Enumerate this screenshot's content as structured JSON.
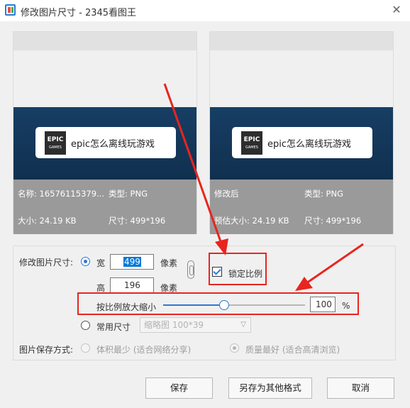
{
  "window": {
    "title": "修改图片尺寸 - 2345看图王",
    "close_glyph": "✕"
  },
  "preview_left": {
    "banner_logo_top": "EPIC",
    "banner_logo_bottom": "GAMES",
    "banner_text": "epic怎么离线玩游戏",
    "name_label": "名称: 16576115379...",
    "type_label": "类型: PNG",
    "size_label": "大小: 24.19 KB",
    "dims_label": "尺寸: 499*196"
  },
  "preview_right": {
    "banner_logo_top": "EPIC",
    "banner_logo_bottom": "GAMES",
    "banner_text": "epic怎么离线玩游戏",
    "name_label": "修改后",
    "type_label": "类型: PNG",
    "size_label": "预估大小: 24.19 KB",
    "dims_label": "尺寸: 499*196"
  },
  "resize": {
    "section_label": "修改图片尺寸:",
    "width_label": "宽",
    "width_value": "499",
    "width_unit": "像素",
    "height_label": "高",
    "height_value": "196",
    "height_unit": "像素",
    "lock_ratio_label": "锁定比例",
    "lock_ratio_checked": true,
    "scale_label": "按比例放大缩小",
    "scale_value": "100",
    "scale_fraction": 0.43,
    "scale_unit": "%",
    "common_size_label": "常用尺寸",
    "common_size_value": "缩略图 100*39",
    "common_size_chevron": "▽"
  },
  "save_mode": {
    "label": "图片保存方式:",
    "option_small": "体积最少 (适合网络分享)",
    "option_quality": "质量最好 (适合高清浏览)"
  },
  "buttons": {
    "save": "保存",
    "save_as": "另存为其他格式",
    "cancel": "取消"
  },
  "colors": {
    "accent": "#2a78d8",
    "annotation_red": "#e8251f",
    "banner_bg": "#173e64"
  }
}
